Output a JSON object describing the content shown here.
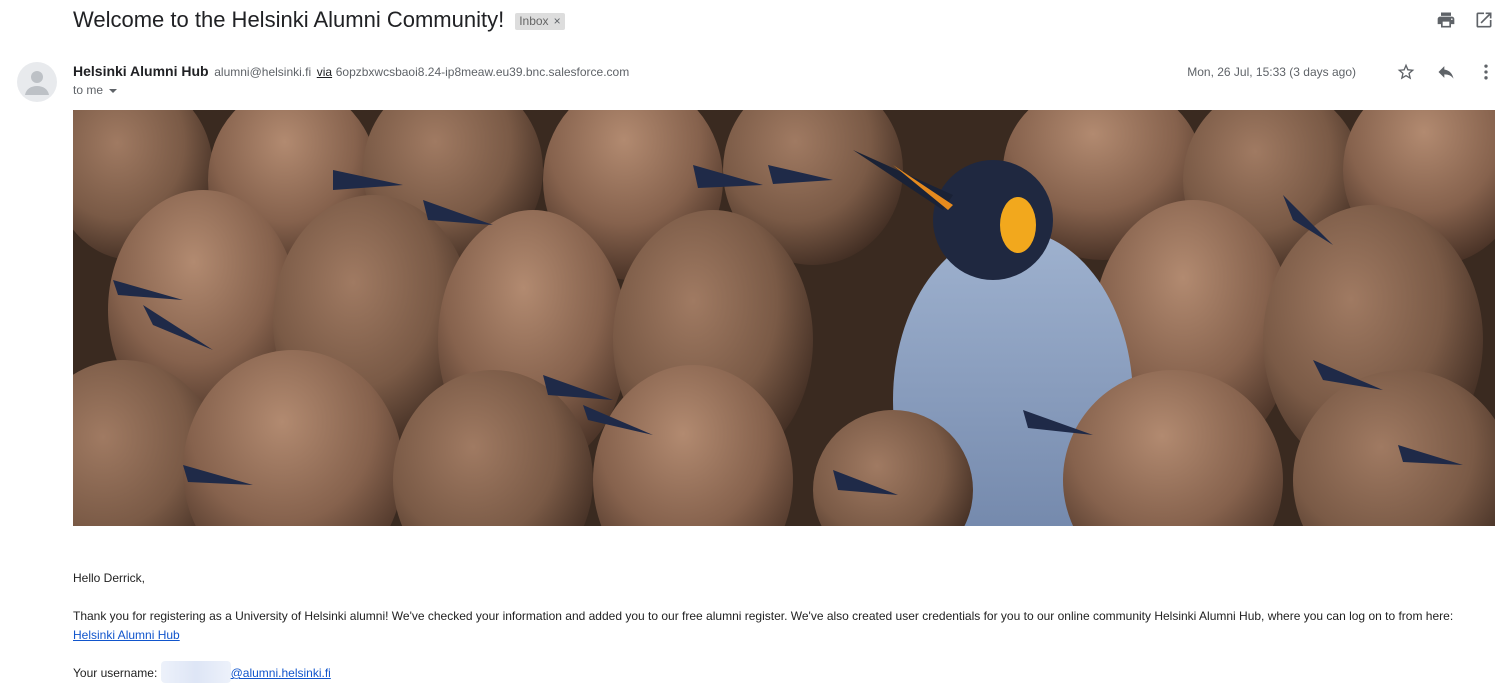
{
  "email": {
    "subject": "Welcome to the Helsinki Alumni Community!",
    "label_chip": "Inbox",
    "label_chip_close": "×",
    "sender": {
      "name": "Helsinki Alumni Hub",
      "email": "alumni@helsinki.fi",
      "via_label": "via",
      "via_domain": "6opzbxwcsbaoi8.24-ip8meaw.eu39.bnc.salesforce.com"
    },
    "to_label": "to me",
    "date": "Mon, 26 Jul, 15:33 (3 days ago)"
  },
  "icons": {
    "print": "print-icon",
    "open_new_window": "open-in-new-window-icon",
    "star": "star-icon",
    "reply": "reply-icon",
    "more": "more-vertical-icon",
    "avatar": "default-avatar-icon"
  },
  "banner_image": {
    "description_name": "penguin-colony-banner",
    "colors": {
      "chick_brown": "#7a5a46",
      "adult_blue": "#8fa4c4",
      "accent_orange": "#f2a81d"
    }
  },
  "body": {
    "greeting": "Hello Derrick,",
    "paragraph1": "Thank you for registering as a University of Helsinki alumni! We've checked your information and added you to our free alumni register. We've also created user credentials for you to our online community Helsinki Alumni Hub, where you can log on to from here: ",
    "paragraph1_link": "Helsinki Alumni Hub",
    "username_label": "Your username: ",
    "username_domain": "@alumni.helsinki.fi"
  }
}
